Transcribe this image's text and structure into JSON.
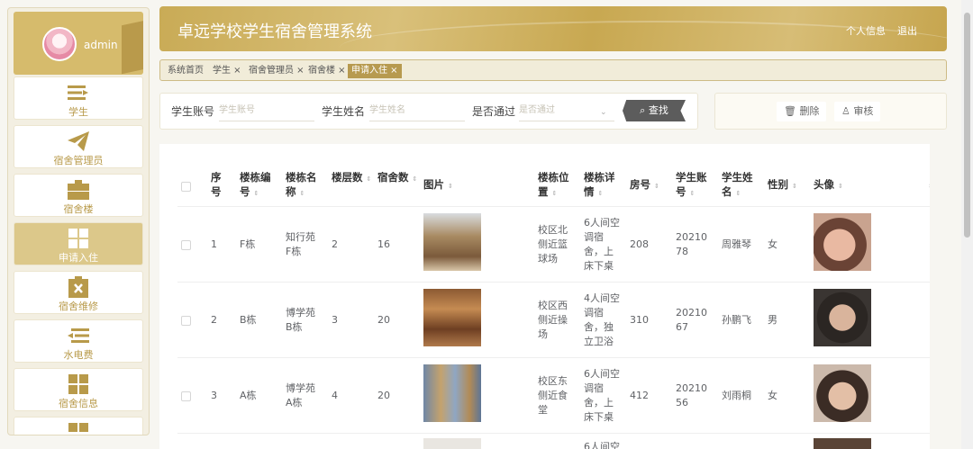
{
  "sidebar": {
    "user": {
      "name": "admin"
    },
    "items": [
      {
        "label": "学生",
        "icon": "list-icon"
      },
      {
        "label": "宿舍管理员",
        "icon": "paper-plane-icon"
      },
      {
        "label": "宿舍楼",
        "icon": "briefcase-icon"
      },
      {
        "label": "申请入住",
        "icon": "grid-icon",
        "active": true
      },
      {
        "label": "宿舍维修",
        "icon": "clipboard-x-icon"
      },
      {
        "label": "水电费",
        "icon": "indent-list-icon"
      },
      {
        "label": "宿舍信息",
        "icon": "grid-icon"
      }
    ]
  },
  "header": {
    "title": "卓远学校学生宿舍管理系统",
    "profile": "个人信息",
    "logout": "退出"
  },
  "tabs": [
    {
      "label": "系统首页"
    },
    {
      "label": "学生 ×"
    },
    {
      "label": "宿舍管理员 ×"
    },
    {
      "label": "宿舍楼 ×"
    },
    {
      "label": "申请入住 ×",
      "active": true
    }
  ],
  "search": {
    "account_label": "学生账号",
    "account_placeholder": "学生账号",
    "name_label": "学生姓名",
    "name_placeholder": "学生姓名",
    "approved_label": "是否通过",
    "approved_placeholder": "是否通过",
    "find_button": "查找"
  },
  "actions": {
    "delete": "删除",
    "review": "审核"
  },
  "table": {
    "headers": [
      "序号",
      "楼栋编号",
      "楼栋名称",
      "楼层数",
      "宿舍数",
      "图片",
      "楼栋位置",
      "楼栋详情",
      "房号",
      "学生账号",
      "学生姓名",
      "性别",
      "头像"
    ],
    "rows": [
      {
        "no": "1",
        "code": "F栋",
        "name": "知行苑F栋",
        "floors": "2",
        "rooms": "16",
        "location": "校区北侧近篮球场",
        "detail": "6人间空调宿舍，上床下桌",
        "room_no": "208",
        "account": "2021078",
        "student": "周雅琴",
        "gender": "女"
      },
      {
        "no": "2",
        "code": "B栋",
        "name": "博学苑B栋",
        "floors": "3",
        "rooms": "20",
        "location": "校区西侧近操场",
        "detail": "4人间空调宿舍，独立卫浴",
        "room_no": "310",
        "account": "2021067",
        "student": "孙鹏飞",
        "gender": "男"
      },
      {
        "no": "3",
        "code": "A栋",
        "name": "博学苑A栋",
        "floors": "4",
        "rooms": "20",
        "location": "校区东侧近食堂",
        "detail": "6人间空调宿舍，上床下桌",
        "room_no": "412",
        "account": "2021056",
        "student": "刘雨桐",
        "gender": "女"
      },
      {
        "detail": "6人间空"
      }
    ]
  }
}
